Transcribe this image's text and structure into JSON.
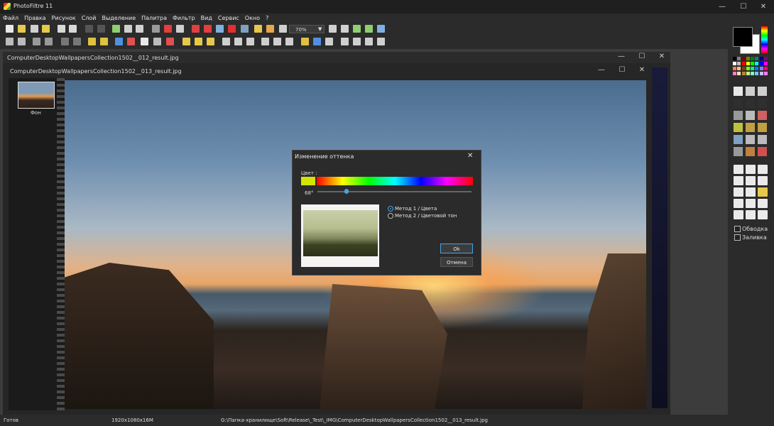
{
  "app": {
    "title": "PhotoFiltre 11"
  },
  "window_controls": {
    "minimize": "—",
    "maximize": "☐",
    "close": "✕"
  },
  "menu": [
    "Файл",
    "Правка",
    "Рисунок",
    "Слой",
    "Выделение",
    "Палитра",
    "Фильтр",
    "Вид",
    "Сервис",
    "Окно",
    "?"
  ],
  "toolbar": {
    "zoom_value": "70%"
  },
  "documents": {
    "doc1_title": "ComputerDesktopWallpapersCollection1502__012_result.jpg",
    "doc2_title": "ComputerDesktopWallpapersCollection1502__013_result.jpg"
  },
  "layers": {
    "layer_label": "Фон"
  },
  "dialog": {
    "title": "Изменение оттенка",
    "close": "✕",
    "color_label": "Цвет :",
    "swatch_color": "#d2e400",
    "hue_angle": "68°",
    "hue_slider_fraction": 0.19,
    "method1": "Метод 1 / Цвета",
    "method2": "Метод 2 / Цветовой тон",
    "selected_method": 1,
    "ok": "Ok",
    "cancel": "Отмена"
  },
  "right_panel": {
    "outline_label": "Обводка",
    "fill_label": "Заливка",
    "fg_color": "#000000",
    "bg_color": "#ffffff"
  },
  "status": {
    "state": "Готов",
    "size": "1920x1080x16M",
    "path": "G:\\Папка-хранилище\\Soft\\Release\\_Test\\_IMG\\ComputerDesktopWallpapersCollection1502__013_result.jpg"
  },
  "colors": {
    "accent": "#4aa3e0"
  }
}
